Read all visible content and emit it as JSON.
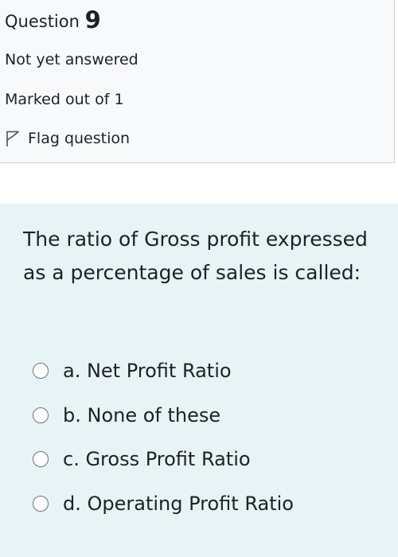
{
  "question_info": {
    "label": "Question",
    "number": "9",
    "state": "Not yet answered",
    "grade": "Marked out of 1",
    "flag_label": "Flag question",
    "flag_icon": "flag-outline-icon"
  },
  "question": {
    "text": "The ratio of Gross profit expressed as a percentage of sales is called:",
    "options": [
      {
        "letter": "a.",
        "text": "Net Profit Ratio",
        "label": "a. Net Profit Ratio",
        "selected": false
      },
      {
        "letter": "b.",
        "text": "None of these",
        "label": "b. None of these",
        "selected": false
      },
      {
        "letter": "c.",
        "text": "Gross Profit Ratio",
        "label": "c. Gross Profit Ratio",
        "selected": false
      },
      {
        "letter": "d.",
        "text": "Operating Profit Ratio",
        "label": "d. Operating Profit Ratio",
        "selected": false
      }
    ]
  },
  "colors": {
    "info_background": "#f8f9fa",
    "content_background": "#e7f3f5",
    "text": "#1d2125",
    "border": "#cfd2d4"
  }
}
